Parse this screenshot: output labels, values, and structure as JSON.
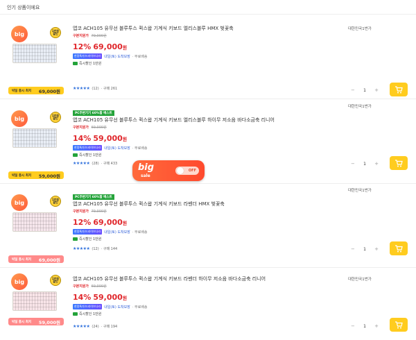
{
  "section": {
    "title": "인기 상품이에요"
  },
  "products": [
    {
      "tag": "",
      "title": "앱코 ACH105 유무선 블루투스 퀵스왑 기계식 키보드 엘리스블루 HMX 벚꽃축",
      "coupon_label": "구본지원가",
      "original_price": "79,000원",
      "discount": "12%",
      "price": "69,000",
      "won": "원",
      "badge": "한정특가/드라이브나라",
      "delivery": "내일(토) 도착보장",
      "shipping": "· 무료배송",
      "card_discount": "즉시할인 1만원",
      "stars": "★★★★★",
      "reviews": "(12)",
      "purchases": "· 구매 261",
      "seller": "대한민국1번가",
      "thumb_big": "big",
      "thumb_corner": "1만원 할인",
      "bar_label": "빅딜 총시 최저",
      "bar_price": "69,000원",
      "qty": "1",
      "minus": "−",
      "plus": "+"
    },
    {
      "tag": "PC주변기기 60%할 베스트",
      "title": "앱코 ACH105 유무선 블루투스 퀵스왑 기계식 키보드 엘리스블루 하이무 저소음 바다소금축 리니어",
      "coupon_label": "구본지원가",
      "original_price": "69,000원",
      "discount": "14%",
      "price": "59,000",
      "won": "원",
      "badge": "한정특가/드라이브나라",
      "delivery": "내일(토) 도착보장",
      "shipping": "· 무료배송",
      "card_discount": "즉시할인 1만원",
      "stars": "★★★★★",
      "reviews": "(28)",
      "purchases": "· 구매 433",
      "seller": "대한민국1번가",
      "thumb_big": "big",
      "thumb_corner": "1만원 할인",
      "bar_label": "빅딜 총시 최저",
      "bar_price": "59,000원",
      "qty": "1",
      "minus": "−",
      "plus": "+"
    },
    {
      "tag": "PC주변기기 60%할 베스트",
      "title": "앱코 ACH105 유무선 블루투스 퀵스왑 기계식 키보드 라벤더 HMX 벚꽃축",
      "coupon_label": "구본지원가",
      "original_price": "79,000원",
      "discount": "12%",
      "price": "69,000",
      "won": "원",
      "badge": "한정특가/드라이브나라",
      "delivery": "내일(토) 도착보장",
      "shipping": "· 무료배송",
      "card_discount": "즉시할인 1만원",
      "stars": "★★★★★",
      "reviews": "(12)",
      "purchases": "· 구매 144",
      "seller": "대한민국1번가",
      "thumb_big": "big",
      "thumb_corner": "1만원 할인",
      "bar_label": "빅딜 총시 최저",
      "bar_price": "69,000원",
      "qty": "1",
      "minus": "−",
      "plus": "+"
    },
    {
      "tag": "",
      "title": "앱코 ACH105 유무선 블루투스 퀵스왑 기계식 키보드 라벤더 하이무 저소음 바다소금축 리니어",
      "coupon_label": "구본지원가",
      "original_price": "69,000원",
      "discount": "14%",
      "price": "59,000",
      "won": "원",
      "badge": "한정특가/드라이브나라",
      "delivery": "내일(토) 도착보장",
      "shipping": "· 무료배송",
      "card_discount": "즉시할인 1만원",
      "stars": "★★★★★",
      "reviews": "(24)",
      "purchases": "· 구매 194",
      "seller": "대한민국1번가",
      "thumb_big": "big",
      "thumb_corner": "1만원 할인",
      "bar_label": "빅딜 총시 최저",
      "bar_price": "59,000원",
      "qty": "1",
      "minus": "−",
      "plus": "+"
    }
  ],
  "banner": {
    "big": "big",
    "sale": "sale",
    "switch_label": "OFF"
  },
  "colors": {
    "accent_red": "#e0262b",
    "cart_yellow": "#ffcc1f",
    "badge_green": "#24a33a",
    "star_blue": "#2d6fdc"
  },
  "icons": {
    "cart": "cart-icon",
    "card": "card-icon"
  }
}
